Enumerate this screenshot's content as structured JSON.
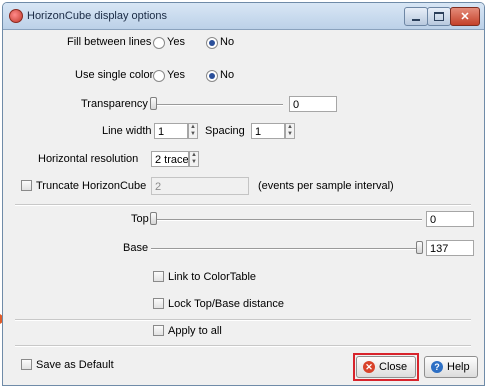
{
  "window": {
    "title": "HorizonCube display options"
  },
  "fill_between_lines": {
    "label": "Fill between lines",
    "options": [
      "Yes",
      "No"
    ],
    "selected": "No"
  },
  "use_single_color": {
    "label": "Use single color",
    "options": [
      "Yes",
      "No"
    ],
    "selected": "No"
  },
  "transparency": {
    "label": "Transparency",
    "value": "0",
    "slider_fraction": 0
  },
  "line_width": {
    "label": "Line width",
    "value": "1"
  },
  "spacing": {
    "label": "Spacing",
    "value": "1"
  },
  "horizontal_resolution": {
    "label": "Horizontal resolution",
    "value": "2 traces"
  },
  "truncate": {
    "label": "Truncate HorizonCube",
    "value": "2",
    "unit": "(events per sample interval)",
    "checked": false
  },
  "top": {
    "label": "Top",
    "value": "0",
    "slider_fraction": 0
  },
  "base": {
    "label": "Base",
    "value": "137",
    "slider_fraction": 1
  },
  "link_to_colortable": {
    "label": "Link to ColorTable",
    "checked": false
  },
  "lock_top_base": {
    "label": "Lock Top/Base distance",
    "checked": false
  },
  "apply_to_all": {
    "label": "Apply to all",
    "checked": false
  },
  "save_as_default": {
    "label": "Save as Default",
    "checked": false
  },
  "buttons": {
    "close": "Close",
    "help": "Help"
  },
  "colors": {
    "highlight": "#d8242c",
    "radio_selected": "#2a4f9a",
    "close_icon": "#d9432b",
    "help_icon": "#2d6fc4"
  }
}
